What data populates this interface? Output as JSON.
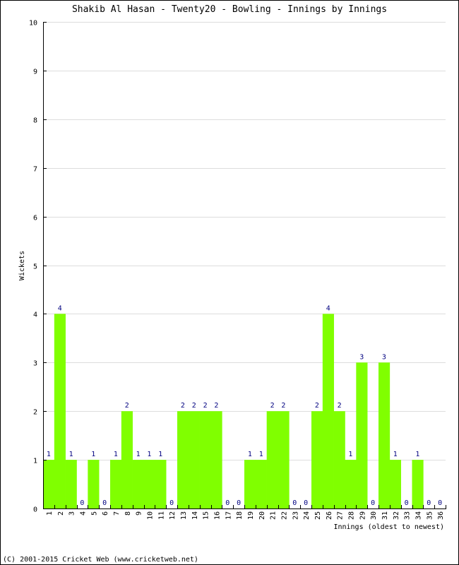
{
  "chart_data": {
    "type": "bar",
    "title": "Shakib Al Hasan - Twenty20 - Bowling - Innings by Innings",
    "xlabel": "Innings (oldest to newest)",
    "ylabel": "Wickets",
    "ylim": [
      0,
      10
    ],
    "yticks": [
      0,
      1,
      2,
      3,
      4,
      5,
      6,
      7,
      8,
      9,
      10
    ],
    "grid": true,
    "bar_color": "#80ff00",
    "label_color": "#000080",
    "categories": [
      "1",
      "2",
      "3",
      "4",
      "5",
      "6",
      "7",
      "8",
      "9",
      "10",
      "11",
      "12",
      "13",
      "14",
      "15",
      "16",
      "17",
      "18",
      "19",
      "20",
      "21",
      "22",
      "23",
      "24",
      "25",
      "26",
      "27",
      "28",
      "29",
      "30",
      "31",
      "32",
      "33",
      "34",
      "35",
      "36"
    ],
    "values": [
      1,
      4,
      1,
      0,
      1,
      0,
      1,
      2,
      1,
      1,
      1,
      0,
      2,
      2,
      2,
      2,
      0,
      0,
      1,
      1,
      2,
      2,
      0,
      0,
      2,
      4,
      2,
      1,
      3,
      0,
      3,
      1,
      0,
      1,
      0,
      0
    ]
  },
  "footer": "(C) 2001-2015 Cricket Web (www.cricketweb.net)"
}
